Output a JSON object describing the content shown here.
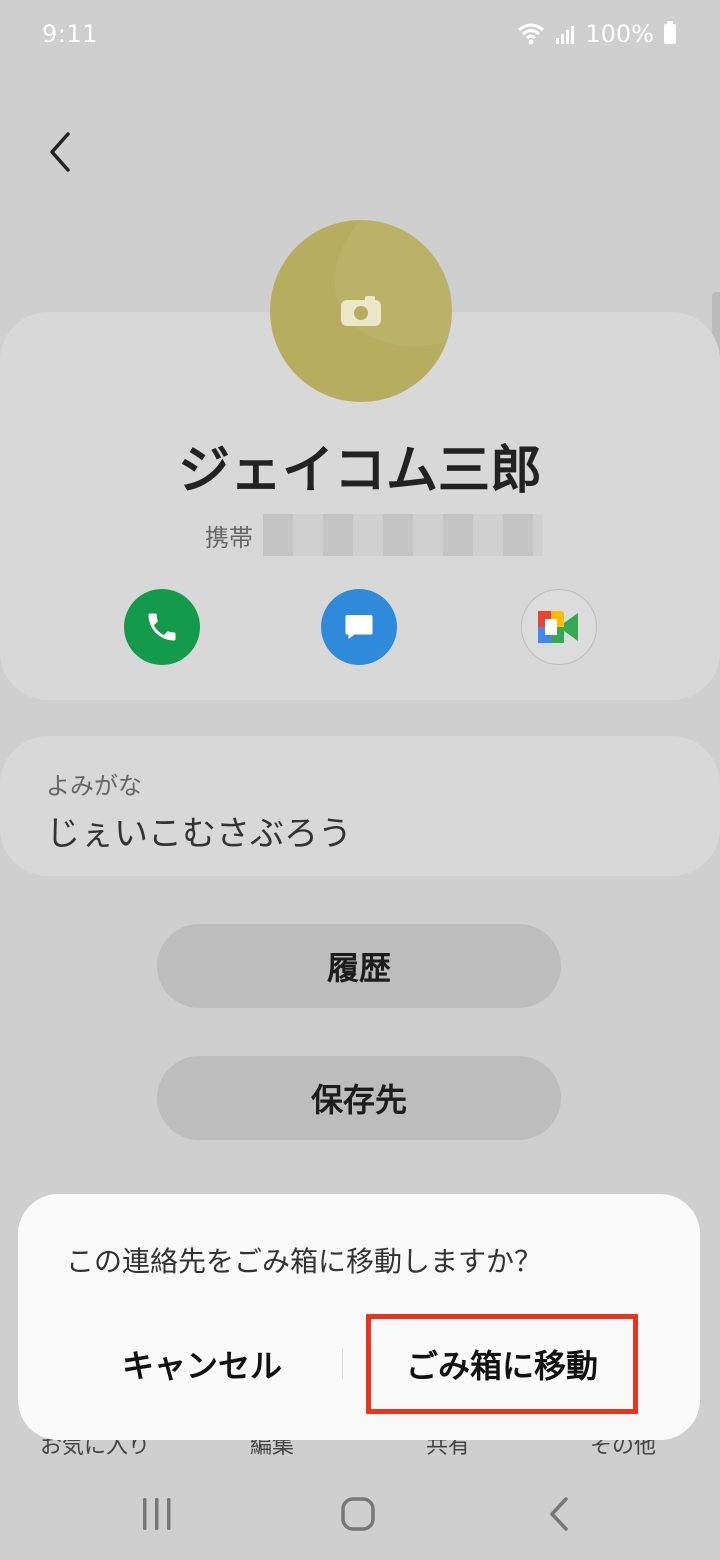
{
  "status_bar": {
    "time": "9:11",
    "battery": "100%"
  },
  "contact": {
    "name": "ジェイコム三郎",
    "phone_label": "携帯",
    "reading_label": "よみがな",
    "reading_value": "じぇいこむさぶろう"
  },
  "buttons": {
    "history": "履歴",
    "storage": "保存先"
  },
  "bottom_bar": {
    "favorites": "お気に入り",
    "edit": "編集",
    "share": "共有",
    "more": "その他"
  },
  "dialog": {
    "message": "この連絡先をごみ箱に移動しますか？",
    "cancel": "キャンセル",
    "confirm": "ごみ箱に移動"
  },
  "colors": {
    "accent_highlight": "#e8351f",
    "call_green": "#139a4a",
    "message_blue": "#2f8bd9",
    "avatar": "#b6ae5e"
  }
}
